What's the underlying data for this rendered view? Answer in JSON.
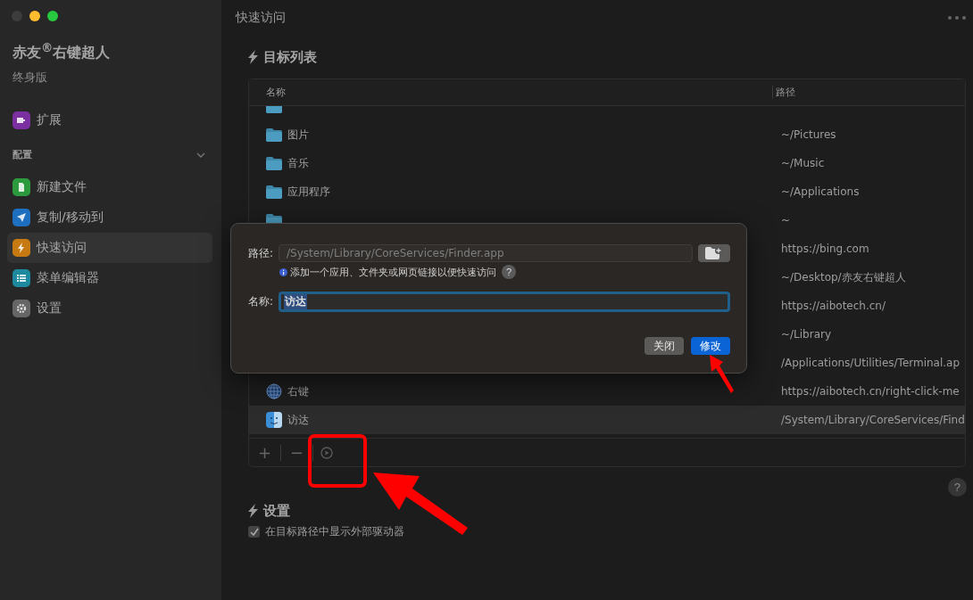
{
  "window": {
    "title": "快速访问"
  },
  "sidebar": {
    "app_name": "赤友$^{®}$右键超人",
    "edition": "终身版",
    "top_items": [
      {
        "label": "扩展",
        "color": "#7b2fa0",
        "selected": false,
        "kind": "extension"
      }
    ],
    "section": {
      "label": "配置",
      "expanded": true
    },
    "items": [
      {
        "label": "新建文件",
        "color": "#2e9a3e",
        "selected": false,
        "kind": "file"
      },
      {
        "label": "复制/移动到",
        "color": "#1f6fc0",
        "selected": false,
        "kind": "send"
      },
      {
        "label": "快速访问",
        "color": "#c77a12",
        "selected": true,
        "kind": "bolt"
      },
      {
        "label": "菜单编辑器",
        "color": "#1e8aa0",
        "selected": false,
        "kind": "list"
      },
      {
        "label": "设置",
        "color": "#666666",
        "selected": false,
        "kind": "gear"
      }
    ]
  },
  "target_list": {
    "heading": "目标列表",
    "columns": [
      "名称",
      "路径"
    ],
    "rows": [
      {
        "kind": "folder",
        "selected": false
      },
      {
        "name": "图片",
        "path": "~/Pictures",
        "kind": "folder",
        "selected": false
      },
      {
        "name": "音乐",
        "path": "~/Music",
        "kind": "folder",
        "selected": false
      },
      {
        "name": "应用程序",
        "path": "~/Applications",
        "kind": "folder",
        "selected": false
      },
      {
        "path": "~",
        "kind": "folder",
        "selected": false
      },
      {
        "path": "https://bing.com",
        "kind": "hidden",
        "selected": false
      },
      {
        "path": "~/Desktop/赤友右键超人",
        "kind": "hidden",
        "selected": false
      },
      {
        "path": "https://aibotech.cn/",
        "kind": "hidden",
        "selected": false
      },
      {
        "path": "~/Library",
        "kind": "hidden",
        "selected": false
      },
      {
        "path": "/Applications/Utilities/Terminal.ap",
        "kind": "hidden",
        "selected": false
      },
      {
        "name": "右键",
        "path": "https://aibotech.cn/right-click-me",
        "kind": "globe",
        "selected": false
      },
      {
        "name": "访达",
        "path": "/System/Library/CoreServices/Find",
        "kind": "finder",
        "selected": true
      }
    ],
    "toolbar": {
      "add": "+",
      "remove": "−"
    }
  },
  "settings": {
    "heading": "设置",
    "options": [
      {
        "label": "在目标路径中显示外部驱动器",
        "checked": true
      }
    ]
  },
  "dialog": {
    "path_label": "路径:",
    "path_value": "/System/Library/CoreServices/Finder.app",
    "hint": "添加一个应用、文件夹或网页链接以便快速访问",
    "hint_help": "?",
    "name_label": "名称:",
    "name_value": "访达",
    "buttons": [
      {
        "label": "关闭",
        "kind": "secondary"
      },
      {
        "label": "修改",
        "kind": "primary"
      }
    ]
  },
  "help": "?"
}
